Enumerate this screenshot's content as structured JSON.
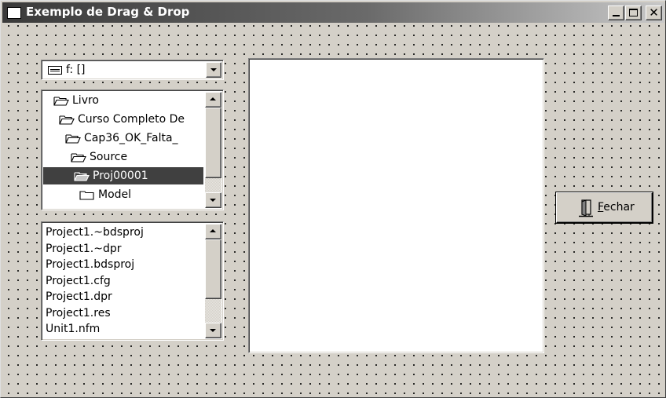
{
  "window": {
    "title": "Exemplo de Drag & Drop",
    "controls": {
      "close_glyph": "✕"
    }
  },
  "drive_combo": {
    "value": "f: []",
    "icon": "drive-icon"
  },
  "directory_list": {
    "items": [
      {
        "label": "Livro",
        "icon": "open-folder-icon",
        "selected": false
      },
      {
        "label": "Curso Completo De",
        "icon": "open-folder-icon",
        "selected": false
      },
      {
        "label": "Cap36_OK_Falta_",
        "icon": "open-folder-icon",
        "selected": false
      },
      {
        "label": "Source",
        "icon": "open-folder-icon",
        "selected": false
      },
      {
        "label": "Proj00001",
        "icon": "open-folder-icon",
        "selected": true
      },
      {
        "label": "Model",
        "icon": "closed-folder-icon",
        "selected": false
      }
    ]
  },
  "file_list": {
    "items": [
      "Project1.~bdsproj",
      "Project1.~dpr",
      "Project1.bdsproj",
      "Project1.cfg",
      "Project1.dpr",
      "Project1.res",
      "Unit1.nfm"
    ]
  },
  "fechar_button": {
    "accel": "F",
    "rest": "echar",
    "icon": "door-icon"
  },
  "colors": {
    "form_background": "#d4d0c8",
    "selection": "#404040",
    "title_start": "#3a3a3a",
    "title_end": "#c8c8c8"
  }
}
